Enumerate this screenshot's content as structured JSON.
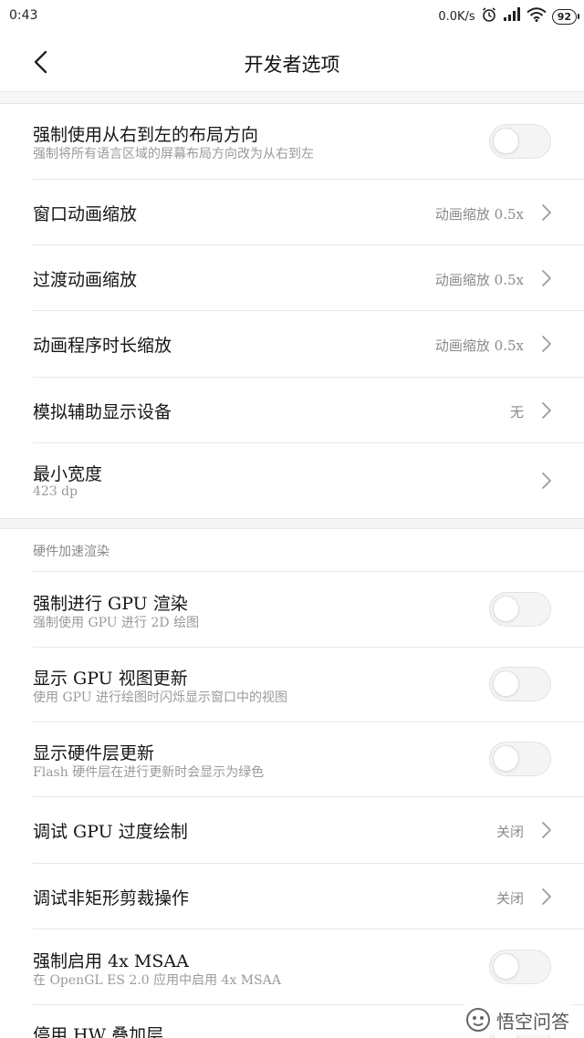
{
  "status_bar": {
    "time": "0:43",
    "network_speed": "0.0K/s",
    "battery": "92",
    "icons": [
      "alarm-icon",
      "signal-icon",
      "wifi-icon",
      "battery-icon"
    ]
  },
  "header": {
    "title": "开发者选项",
    "back_icon": "back-chevron-icon"
  },
  "rows_top": [
    {
      "title": "强制使用从右到左的布局方向",
      "subtitle": "强制将所有语言区域的屏幕布局方向改为从右到左",
      "control": "toggle",
      "checked": false
    },
    {
      "title": "窗口动画缩放",
      "value": "动画缩放 0.5x",
      "control": "chevron"
    },
    {
      "title": "过渡动画缩放",
      "value": "动画缩放 0.5x",
      "control": "chevron"
    },
    {
      "title": "动画程序时长缩放",
      "value": "动画缩放 0.5x",
      "control": "chevron"
    },
    {
      "title": "模拟辅助显示设备",
      "value": "无",
      "control": "chevron"
    },
    {
      "title": "最小宽度",
      "subtitle": "423 dp",
      "control": "chevron"
    }
  ],
  "section": {
    "header": "硬件加速渲染"
  },
  "rows_hw": [
    {
      "title": "强制进行 GPU 渲染",
      "subtitle": "强制使用 GPU 进行 2D 绘图",
      "control": "toggle",
      "checked": false
    },
    {
      "title": "显示 GPU 视图更新",
      "subtitle": "使用 GPU 进行绘图时闪烁显示窗口中的视图",
      "control": "toggle",
      "checked": false
    },
    {
      "title": "显示硬件层更新",
      "subtitle": "Flash 硬件层在进行更新时会显示为绿色",
      "control": "toggle",
      "checked": false
    },
    {
      "title": "调试 GPU 过度绘制",
      "value": "关闭",
      "control": "chevron"
    },
    {
      "title": "调试非矩形剪裁操作",
      "value": "关闭",
      "control": "chevron"
    },
    {
      "title": "强制启用 4x MSAA",
      "subtitle": "在 OpenGL ES 2.0 应用中启用 4x MSAA",
      "control": "toggle",
      "checked": false
    },
    {
      "title": "停用 HW 叠加层",
      "control": "toggle",
      "checked": false
    }
  ],
  "watermark": {
    "text": "悟空问答",
    "icon": "wukong-logo-icon"
  }
}
